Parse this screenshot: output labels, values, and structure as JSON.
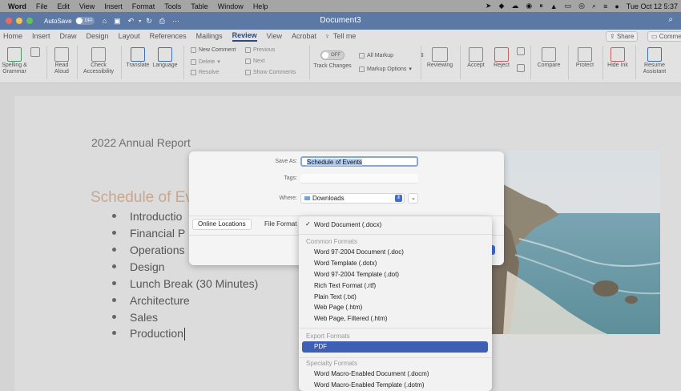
{
  "menubar": {
    "app": "Word",
    "items": [
      "File",
      "Edit",
      "View",
      "Insert",
      "Format",
      "Tools",
      "Table",
      "Window",
      "Help"
    ],
    "clock": "Tue Oct 12  5:37"
  },
  "titlebar": {
    "autosave": "AutoSave",
    "autosave_state": "OFF",
    "document_title": "Document3"
  },
  "tabs": [
    "Home",
    "Insert",
    "Draw",
    "Design",
    "Layout",
    "References",
    "Mailings",
    "Review",
    "View",
    "Acrobat",
    "Tell me"
  ],
  "active_tab": "Review",
  "share": "Share",
  "comments": "Comments",
  "ribbon": {
    "spelling": "Spelling & Grammar",
    "read_aloud": "Read Aloud",
    "check_access": "Check Accessibility",
    "translate": "Translate",
    "language": "Language",
    "new_comment": "New Comment",
    "delete": "Delete",
    "resolve": "Resolve",
    "previous": "Previous",
    "next": "Next",
    "show_comments": "Show Comments",
    "track_toggle": "OFF",
    "track_changes": "Track Changes",
    "all_markup": "All Markup",
    "markup_options": "Markup Options",
    "reviewing": "Reviewing",
    "accept": "Accept",
    "reject": "Reject",
    "compare": "Compare",
    "protect": "Protect",
    "hide_ink": "Hide Ink",
    "resume_assistant": "Resume Assistant"
  },
  "document": {
    "report_title": "2022 Annual Report",
    "heading": "Schedule of Ev",
    "bullets": [
      "Introductio",
      "Financial P",
      "Operations",
      "Design",
      "Lunch Break (30 Minutes)",
      "Architecture",
      "Sales",
      "Production"
    ]
  },
  "save_dialog": {
    "save_as_label": "Save As:",
    "save_as_value": "Schedule of Events",
    "tags_label": "Tags:",
    "where_label": "Where:",
    "where_value": "Downloads",
    "online_locations": "Online Locations",
    "file_format_label": "File Format"
  },
  "format_menu": {
    "selected": "Word Document (.docx)",
    "common_header": "Common Formats",
    "common": [
      "Word 97-2004 Document (.doc)",
      "Word Template (.dotx)",
      "Word 97-2004 Template (.dot)",
      "Rich Text Format (.rtf)",
      "Plain Text (.txt)",
      "Web Page (.htm)",
      "Web Page, Filtered (.htm)"
    ],
    "export_header": "Export Formats",
    "export_highlighted": "PDF",
    "specialty_header": "Specialty Formats",
    "specialty": [
      "Word Macro-Enabled Document (.docm)",
      "Word Macro-Enabled Template (.dotm)"
    ]
  },
  "colors": {
    "titlebar": "#5c79a6",
    "highlight": "#3d5fb4",
    "heading": "#c9a68e"
  }
}
